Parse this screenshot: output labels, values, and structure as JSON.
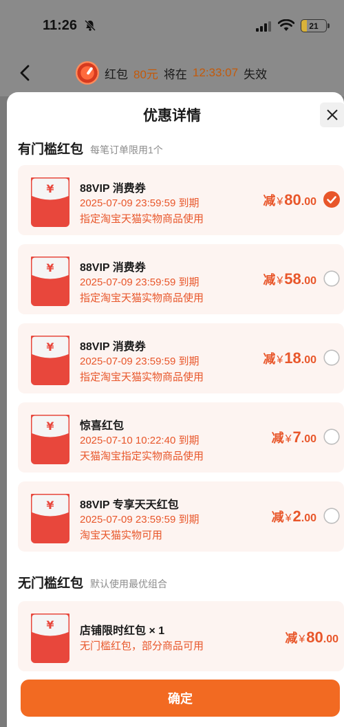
{
  "status": {
    "time": "11:26",
    "battery": "21"
  },
  "countdown": {
    "prefix": "红包",
    "amount": "80元",
    "mid": "将在",
    "time": "12:33:07",
    "suffix": "失效"
  },
  "sheet": {
    "title": "优惠详情"
  },
  "threshold_section": {
    "title": "有门槛红包",
    "subtitle": "每笔订单限用1个"
  },
  "no_threshold_section": {
    "title": "无门槛红包",
    "subtitle": "默认使用最优组合"
  },
  "coupons": [
    {
      "name": "88VIP 消费券",
      "expiry": "2025-07-09 23:59:59 到期",
      "scope": "指定淘宝天猫实物商品使用",
      "prefix": "减",
      "yen": "¥",
      "int": "80",
      "dec": ".00",
      "selected": true
    },
    {
      "name": "88VIP 消费券",
      "expiry": "2025-07-09 23:59:59 到期",
      "scope": "指定淘宝天猫实物商品使用",
      "prefix": "减",
      "yen": "¥",
      "int": "58",
      "dec": ".00",
      "selected": false
    },
    {
      "name": "88VIP 消费券",
      "expiry": "2025-07-09 23:59:59 到期",
      "scope": "指定淘宝天猫实物商品使用",
      "prefix": "减",
      "yen": "¥",
      "int": "18",
      "dec": ".00",
      "selected": false
    },
    {
      "name": "惊喜红包",
      "expiry": "2025-07-10 10:22:40 到期",
      "scope": "天猫淘宝指定实物商品使用",
      "prefix": "减",
      "yen": "¥",
      "int": "7",
      "dec": ".00",
      "selected": false
    },
    {
      "name": "88VIP 专享天天红包",
      "expiry": "2025-07-09 23:59:59 到期",
      "scope": "淘宝天猫实物可用",
      "prefix": "减",
      "yen": "¥",
      "int": "2",
      "dec": ".00",
      "selected": false
    }
  ],
  "store_coupon": {
    "name": "店铺限时红包 × 1",
    "desc": "无门槛红包，部分商品可用",
    "prefix": "减",
    "yen": "¥",
    "int": "80",
    "dec": ".00"
  },
  "confirm": {
    "label": "确定"
  },
  "colors": {
    "accent": "#e8562a",
    "button": "#f26a22",
    "card_bg": "#fdf4f1",
    "envelope": "#e8473c"
  },
  "icons": {
    "envelope": "red-envelope-icon",
    "check": "check-circle-icon",
    "radio": "radio-empty-icon",
    "close": "close-icon",
    "back": "back-arrow-icon"
  }
}
